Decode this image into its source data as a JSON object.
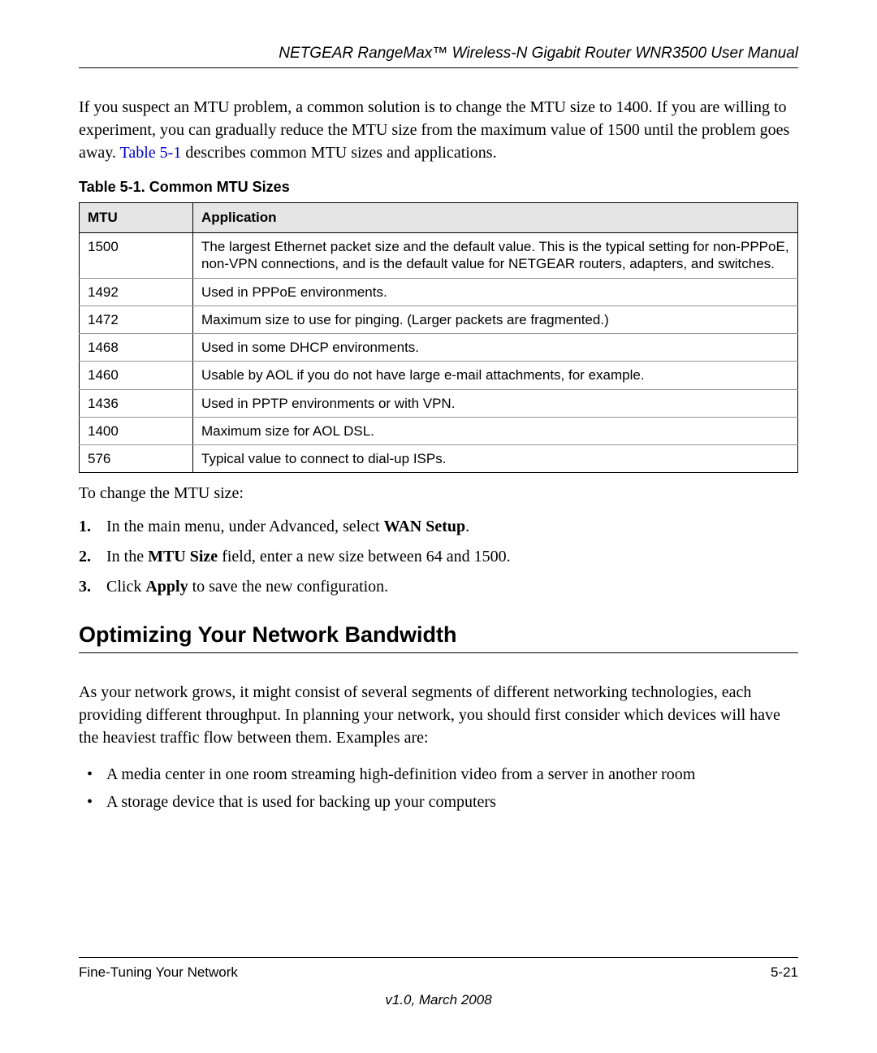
{
  "header": {
    "title": "NETGEAR RangeMax™ Wireless-N Gigabit Router WNR3500 User Manual"
  },
  "intro": {
    "part1": "If you suspect an MTU problem, a common solution is to change the MTU size to 1400. If you are willing to experiment, you can gradually reduce the MTU size from the maximum value of 1500 until the problem goes away. ",
    "table_ref": "Table 5-1",
    "part2": " describes common MTU sizes and applications."
  },
  "table": {
    "caption": "Table 5-1.  Common MTU Sizes",
    "headers": {
      "col1": "MTU",
      "col2": "Application"
    },
    "rows": [
      {
        "mtu": "1500",
        "app": "The largest Ethernet packet size and the default value. This is the typical setting for non-PPPoE, non-VPN connections, and is the default value for NETGEAR routers, adapters, and switches."
      },
      {
        "mtu": "1492",
        "app": "Used in PPPoE environments."
      },
      {
        "mtu": "1472",
        "app": "Maximum size to use for pinging. (Larger packets are fragmented.)"
      },
      {
        "mtu": "1468",
        "app": "Used in some DHCP environments."
      },
      {
        "mtu": "1460",
        "app": "Usable by AOL if you do not have large e-mail attachments, for example."
      },
      {
        "mtu": "1436",
        "app": "Used in PPTP environments or with VPN."
      },
      {
        "mtu": "1400",
        "app": "Maximum size for AOL DSL."
      },
      {
        "mtu": "576",
        "app": "Typical value to connect to dial-up ISPs."
      }
    ]
  },
  "steps": {
    "intro": "To change the MTU size:",
    "items": [
      {
        "t1": "In the main menu, under Advanced, select ",
        "b1": "WAN Setup",
        "t2": "."
      },
      {
        "t1": "In the ",
        "b1": "MTU Size",
        "t2": " field, enter a new size between 64 and 1500."
      },
      {
        "t1": "Click ",
        "b1": "Apply",
        "t2": " to save the new configuration."
      }
    ]
  },
  "section": {
    "heading": "Optimizing Your Network Bandwidth",
    "text": "As your network grows, it might consist of several segments of different networking technologies, each providing different throughput. In planning your network, you should first consider which devices will have the heaviest traffic flow between them. Examples are:",
    "bullets": [
      "A media center in one room streaming high-definition video from a server in another room",
      "A storage device that is used for backing up your computers"
    ]
  },
  "footer": {
    "left": "Fine-Tuning Your Network",
    "right": "5-21",
    "version": "v1.0, March 2008"
  }
}
